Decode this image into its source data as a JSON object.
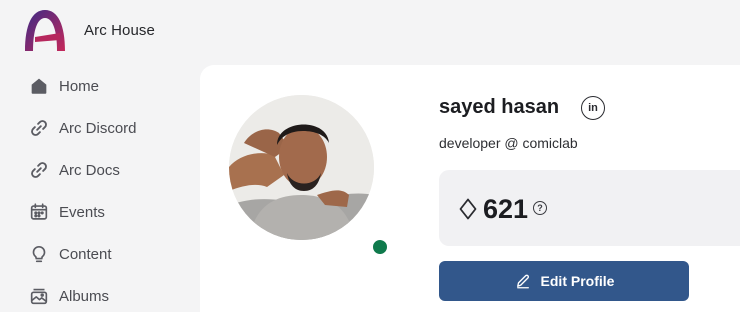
{
  "app": {
    "title": "Arc House",
    "logo_icon": "arc-house-logo"
  },
  "sidebar": {
    "items": [
      {
        "label": "Home",
        "icon": "home-icon"
      },
      {
        "label": "Arc Discord",
        "icon": "link-icon"
      },
      {
        "label": "Arc Docs",
        "icon": "link-icon"
      },
      {
        "label": "Events",
        "icon": "calendar-icon"
      },
      {
        "label": "Content",
        "icon": "lightbulb-icon"
      },
      {
        "label": "Albums",
        "icon": "album-icon"
      }
    ]
  },
  "profile": {
    "name": "sayed hasan",
    "linkedin_label": "in",
    "bio": "developer @ comiclab",
    "status": "online",
    "status_color": "#0f7a4c",
    "points": "621",
    "points_icon": "gem-icon",
    "help_label": "?",
    "edit_label": "Edit Profile",
    "edit_icon": "pencil-icon"
  },
  "colors": {
    "accent": "#32578b",
    "background": "#f4f4f5",
    "card": "#ffffff"
  }
}
